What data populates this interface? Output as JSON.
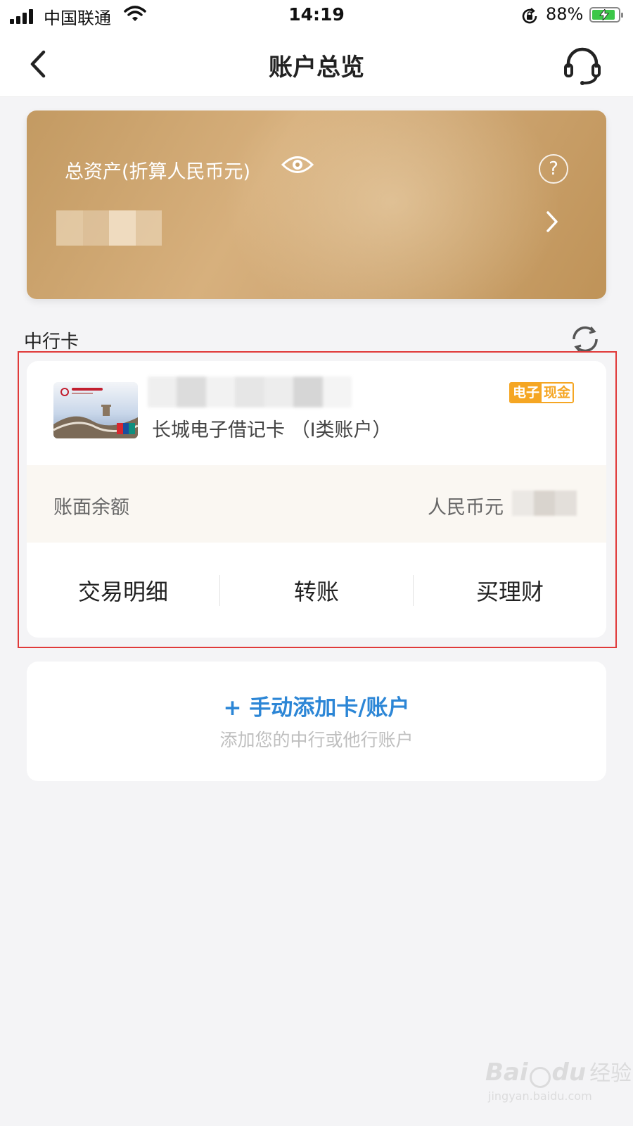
{
  "status_bar": {
    "carrier": "中国联通",
    "time": "14:19",
    "battery_percent": "88%",
    "battery_level": 0.88,
    "charging": true
  },
  "header": {
    "title": "账户总览",
    "back_icon": "chevron-left-icon",
    "service_icon": "headset-icon"
  },
  "asset_card": {
    "label": "总资产(折算人民币元)",
    "amount_masked": true,
    "icons": [
      "eye-icon",
      "question-icon",
      "chevron-right-icon"
    ],
    "colors": {
      "gold_start": "#c39a62",
      "gold_end": "#bf9358"
    }
  },
  "section": {
    "title": "中行卡",
    "refresh_icon": "refresh-icon"
  },
  "account": {
    "card_name": "长城电子借记卡 （I类账户）",
    "number_masked": true,
    "tag": {
      "part1": "电子",
      "part2": "现金",
      "color": "#f5a623"
    },
    "balance_label": "账面余额",
    "currency": "人民币元",
    "balance_masked": true,
    "actions": [
      "交易明细",
      "转账",
      "买理财"
    ]
  },
  "add_account": {
    "title": "+ 手动添加卡/账户",
    "subtitle": "添加您的中行或他行账户",
    "color": "#2c86d6"
  },
  "highlight_color": "#e03a3a",
  "watermark": {
    "brand": "Bai",
    "brand_suffix": "du",
    "cn": "经验",
    "url": "jingyan.baidu.com"
  }
}
